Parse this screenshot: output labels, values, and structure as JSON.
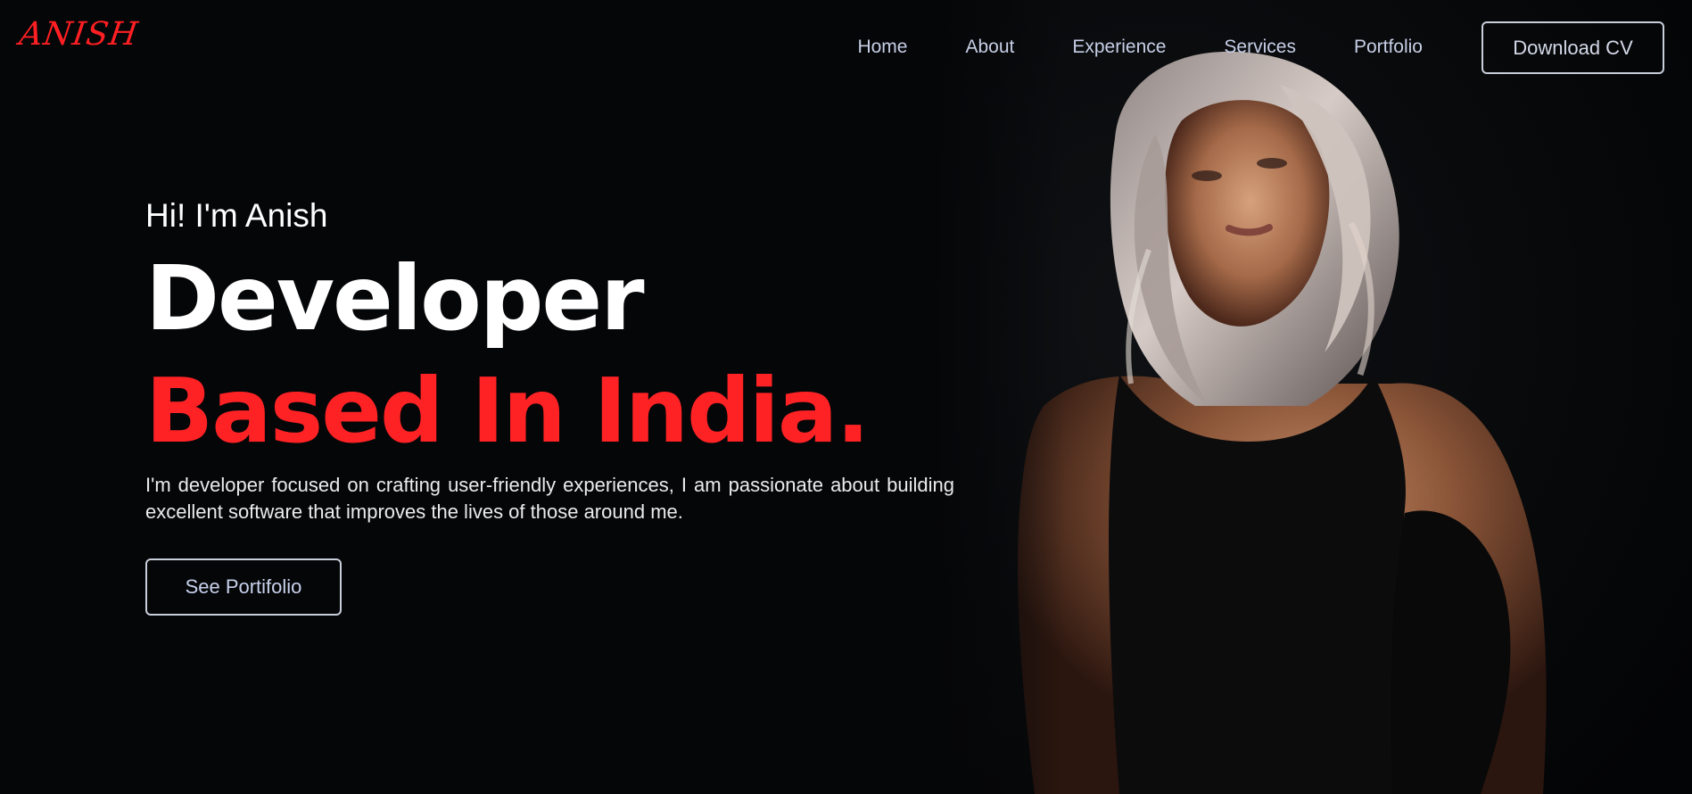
{
  "brand": {
    "logo_text": "ANISH",
    "accent_color": "#ff2225"
  },
  "nav": {
    "items": [
      {
        "label": "Home"
      },
      {
        "label": "About"
      },
      {
        "label": "Experience"
      },
      {
        "label": "Services"
      },
      {
        "label": "Portfolio"
      }
    ],
    "cta_label": "Download CV"
  },
  "hero": {
    "greeting": "Hi! I'm Anish",
    "role": "Developer",
    "location": "Based In India.",
    "bio": "I'm developer focused on crafting user-friendly experiences, I am passionate about building excellent software that improves the lives of those around me.",
    "button_label": "See Portifolio",
    "image_subject": "portrait of a woman in black top on dark background"
  },
  "colors": {
    "background": "#050608",
    "text": "#ffffff",
    "nav_text": "#c7cfe6",
    "button_border": "#c8ceda"
  }
}
